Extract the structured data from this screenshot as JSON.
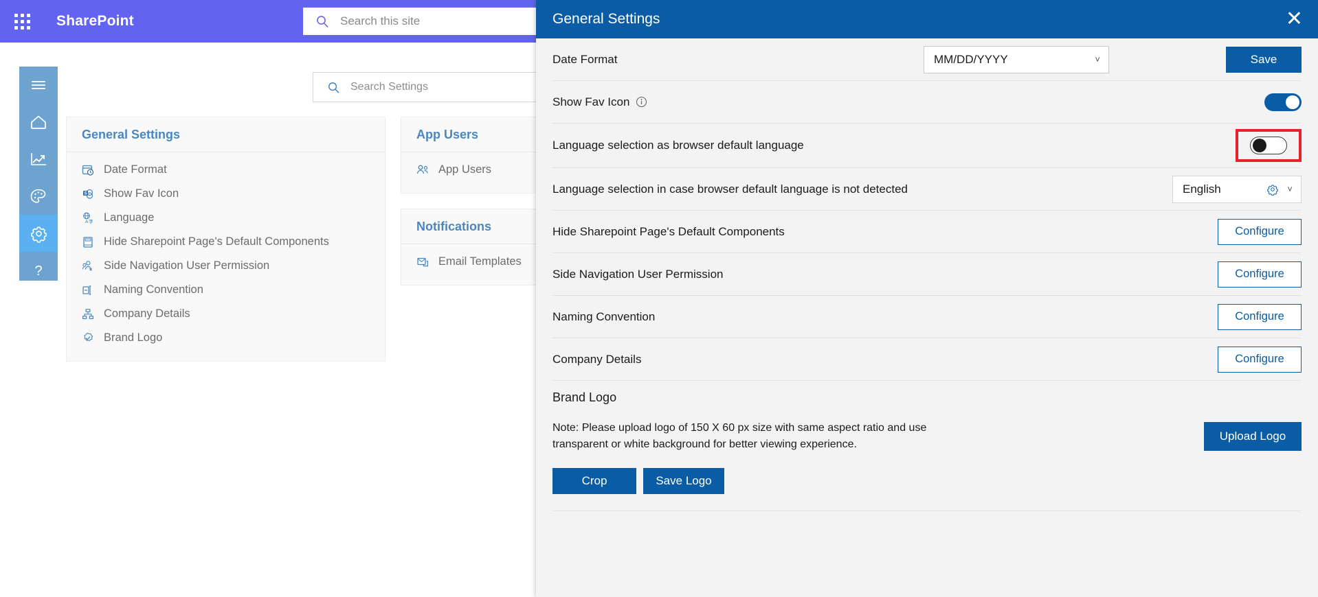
{
  "suitebar": {
    "brand": "SharePoint",
    "search_placeholder": "Search this site",
    "waffle_icon": "app-launcher-icon",
    "search_icon": "search-icon"
  },
  "rail": {
    "items": [
      {
        "name": "menu",
        "icon": "hamburger-icon",
        "active": false
      },
      {
        "name": "home",
        "icon": "home-icon",
        "active": false
      },
      {
        "name": "analytics",
        "icon": "chart-line-icon",
        "active": false
      },
      {
        "name": "theme",
        "icon": "palette-icon",
        "active": false
      },
      {
        "name": "settings",
        "icon": "gear-icon",
        "active": true
      },
      {
        "name": "help",
        "icon": "question-mark-icon",
        "active": false
      }
    ]
  },
  "settings_search": {
    "placeholder": "Search Settings",
    "icon": "search-icon"
  },
  "cards": [
    {
      "title": "General Settings",
      "rows": [
        {
          "label": "Date Format",
          "icon": "calendar-clock-icon"
        },
        {
          "label": "Show Fav Icon",
          "icon": "favicon-icon"
        },
        {
          "label": "Language",
          "icon": "language-globe-icon"
        },
        {
          "label": "Hide Sharepoint Page's Default Components",
          "icon": "page-layout-icon"
        },
        {
          "label": "Side Navigation User Permission",
          "icon": "user-permission-icon"
        },
        {
          "label": "Naming Convention",
          "icon": "rename-icon"
        },
        {
          "label": "Company Details",
          "icon": "org-chart-icon"
        },
        {
          "label": "Brand Logo",
          "icon": "badge-icon"
        }
      ]
    },
    {
      "title": "App Users",
      "rows": [
        {
          "label": "App Users",
          "icon": "people-icon"
        }
      ]
    },
    {
      "title": "Notifications",
      "rows": [
        {
          "label": "Email Templates",
          "icon": "email-template-icon"
        }
      ]
    }
  ],
  "panel": {
    "title": "General Settings",
    "close_icon": "close-icon",
    "date_format": {
      "label": "Date Format",
      "value": "MM/DD/YYYY",
      "chevron_icon": "chevron-down-icon",
      "save_label": "Save"
    },
    "show_fav_icon": {
      "label": "Show Fav Icon",
      "info_icon": "info-circle-icon",
      "toggle_state": "on"
    },
    "lang_browser_default": {
      "label": "Language selection as browser default language",
      "toggle_state": "off",
      "highlighted": true,
      "highlight_color": "#e8202a"
    },
    "lang_fallback": {
      "label": "Language selection in case browser default language is not detected",
      "value": "English",
      "gear_icon": "gear-icon",
      "chevron_icon": "chevron-down-icon"
    },
    "configure_rows": [
      {
        "label": "Hide Sharepoint Page's Default Components",
        "button": "Configure"
      },
      {
        "label": "Side Navigation User Permission",
        "button": "Configure"
      },
      {
        "label": "Naming Convention",
        "button": "Configure"
      },
      {
        "label": "Company Details",
        "button": "Configure"
      }
    ],
    "brand_logo": {
      "title": "Brand Logo",
      "note": "Note: Please upload logo of 150 X 60 px size with same aspect ratio and use transparent or white background for better viewing experience.",
      "upload_label": "Upload Logo",
      "crop_label": "Crop",
      "save_logo_label": "Save Logo"
    }
  },
  "colors": {
    "suitebar": "#6264f0",
    "panel_header": "#0a5ca4",
    "rail": "#6da3ce",
    "rail_active": "#5bb0f2",
    "accent_link": "#4a87bd",
    "highlight": "#e8202a"
  }
}
